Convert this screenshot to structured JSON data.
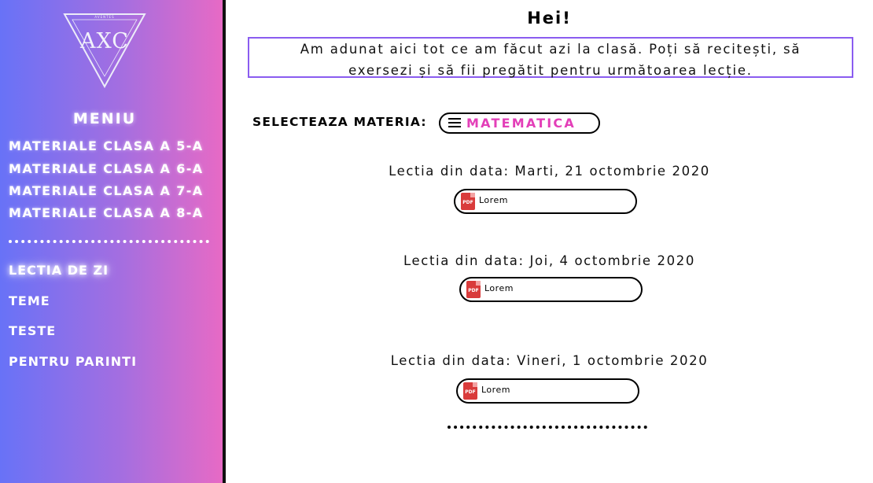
{
  "sidebar": {
    "logo_small": "AVENTES",
    "logo_text": "AXC",
    "menu_title": "MENIU",
    "class_items": [
      {
        "label": "MATERIALE CLASA A 5-A"
      },
      {
        "label": "MATERIALE CLASA A 6-A"
      },
      {
        "label": "MATERIALE CLASA A 7-A"
      },
      {
        "label": "MATERIALE CLASA A 8-A"
      }
    ],
    "nav_items": [
      {
        "label": "LECTIA DE ZI",
        "active": true
      },
      {
        "label": "TEME"
      },
      {
        "label": "TESTE"
      },
      {
        "label": "PENTRU PARINTI"
      }
    ]
  },
  "main": {
    "greeting": "Hei!",
    "intro_line1": "Am adunat aici tot ce am făcut azi la clasă. Poți să recitești, să",
    "intro_line2": "exersezi și să fii pregătit pentru următoarea lecție.",
    "select_label": "SELECTEAZA MATERIA:",
    "selected_subject": "MATEMATICA",
    "lessons": [
      {
        "date": "Lectia din data: Marti, 21 octombrie 2020",
        "file": "Lorem",
        "icon": "pdf-icon"
      },
      {
        "date": "Lectia din data: Joi, 4 octombrie 2020",
        "file": "Lorem",
        "icon": "pdf-icon"
      },
      {
        "date": "Lectia din data: Vineri, 1 octombrie 2020",
        "file": "Lorem",
        "icon": "pdf-icon"
      }
    ]
  },
  "colors": {
    "sidebar_gradient_start": "#6872f7",
    "sidebar_gradient_end": "#e76ac5",
    "accent_pink": "#e33fb8",
    "intro_border": "#8a5cf0",
    "pdf_red": "#d93b3b"
  }
}
